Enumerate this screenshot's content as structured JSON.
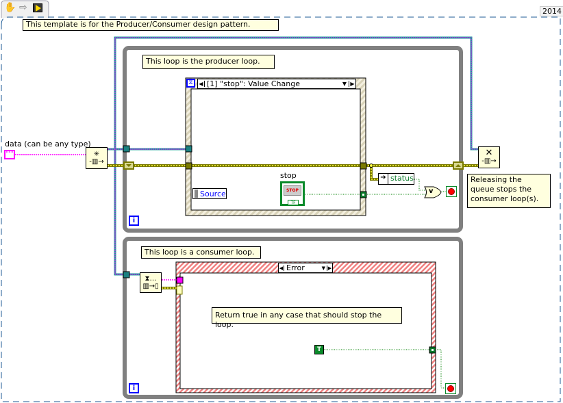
{
  "toolbar": {
    "icons": [
      "hand-tool-icon",
      "arrow-icon",
      "run-vi-icon"
    ]
  },
  "version_label": "2014",
  "comments": {
    "template": "This template is for the Producer/Consumer design pattern.",
    "producer": "This loop is the producer loop.",
    "consumer": "This loop is a consumer loop.",
    "release": "Releasing the queue stops the consumer loop(s).",
    "return_true": "Return true in any case that should stop the loop."
  },
  "data_label": "data (can be any type)",
  "event_structure": {
    "selector": "[1] \"stop\": Value Change",
    "source_label": "Source"
  },
  "stop_control": {
    "label": "stop",
    "button_text": "STOP",
    "terminal_type": "TF"
  },
  "unbundle": {
    "field": "status"
  },
  "or_gate": {
    "symbol": "v"
  },
  "case_structure": {
    "selector": "Error"
  },
  "true_constant": "T",
  "iteration_terminal": "i",
  "colors": {
    "loop_border": "#808080",
    "refnum_wire": "#ff00ff",
    "cluster_wire": "#9a9a00",
    "boolean_wire": "#008000",
    "comment_bg": "#ffffdf",
    "frame_dash": "#1c5a96"
  }
}
